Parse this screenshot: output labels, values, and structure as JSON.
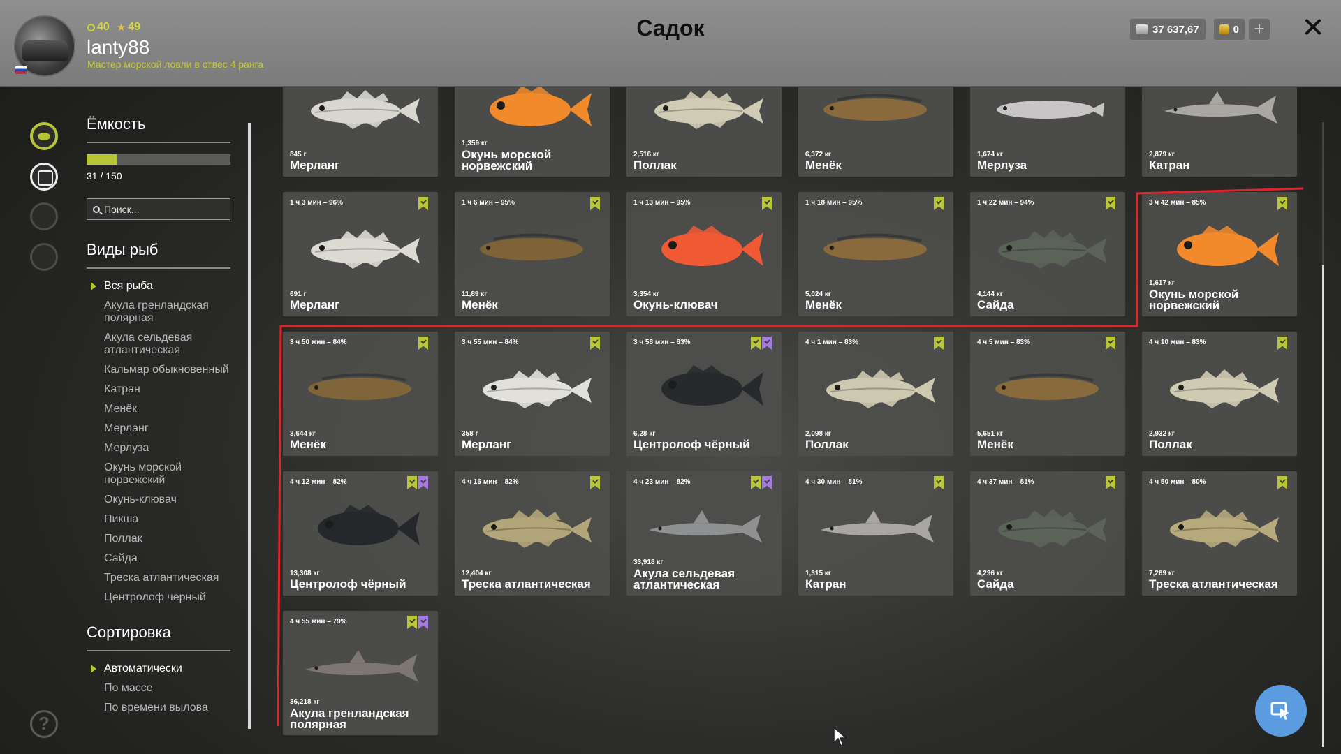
{
  "header": {
    "title": "Садок",
    "username": "lanty88",
    "level": "40",
    "stars": "49",
    "rank": "Мастер морской ловли в отвес 4 ранга",
    "silver": "37 637,67",
    "gold": "0",
    "plus_label": "+",
    "close_label": "✕"
  },
  "sidebar": {
    "capacity_title": "Ёмкость",
    "capacity_text": "31 / 150",
    "capacity_fraction": 0.207,
    "search_placeholder": "Поиск...",
    "species_title": "Виды рыб",
    "species": [
      "Вся рыба",
      "Акула гренландская полярная",
      "Акула сельдевая атлантическая",
      "Кальмар обыкновенный",
      "Катран",
      "Менёк",
      "Мерланг",
      "Мерлуза",
      "Окунь морской норвежский",
      "Окунь-клювач",
      "Пикша",
      "Поллак",
      "Сайда",
      "Треска атлантическая",
      "Центролоф чёрный"
    ],
    "sort_title": "Сортировка",
    "sort_options": [
      "Автоматически",
      "По массе",
      "По времени вылова"
    ],
    "help_label": "?"
  },
  "fish_cards": [
    {
      "time": "",
      "weight": "845 г",
      "name": "Мерланг",
      "marks": [],
      "color": "#d8d6cf",
      "shape": "cod"
    },
    {
      "time": "",
      "weight": "1,359 кг",
      "name": "Окунь морской норвежский",
      "marks": [],
      "color": "#f08a2a",
      "shape": "perch"
    },
    {
      "time": "",
      "weight": "2,516 кг",
      "name": "Поллак",
      "marks": [],
      "color": "#cfcbb4",
      "shape": "cod"
    },
    {
      "time": "",
      "weight": "6,372 кг",
      "name": "Менёк",
      "marks": [],
      "color": "#8a6a3c",
      "shape": "eel"
    },
    {
      "time": "",
      "weight": "1,674 кг",
      "name": "Мерлуза",
      "marks": [],
      "color": "#c9c5c7",
      "shape": "slim"
    },
    {
      "time": "",
      "weight": "2,879 кг",
      "name": "Катран",
      "marks": [],
      "color": "#aaa6a2",
      "shape": "shark"
    },
    {
      "time": "1 ч 3 мин – 96%",
      "weight": "691 г",
      "name": "Мерланг",
      "marks": [
        "green"
      ],
      "color": "#dcdad3",
      "shape": "cod"
    },
    {
      "time": "1 ч 6 мин – 95%",
      "weight": "11,89 кг",
      "name": "Менёк",
      "marks": [
        "green"
      ],
      "color": "#7e6238",
      "shape": "eel"
    },
    {
      "time": "1 ч 13 мин – 95%",
      "weight": "3,354 кг",
      "name": "Окунь-клювач",
      "marks": [
        "green"
      ],
      "color": "#ef5a35",
      "shape": "perch"
    },
    {
      "time": "1 ч 18 мин – 95%",
      "weight": "5,024 кг",
      "name": "Менёк",
      "marks": [
        "green"
      ],
      "color": "#8a6a3c",
      "shape": "eel"
    },
    {
      "time": "1 ч 22 мин – 94%",
      "weight": "4,144 кг",
      "name": "Сайда",
      "marks": [
        "green"
      ],
      "color": "#5b6358",
      "shape": "cod"
    },
    {
      "time": "3 ч 42 мин – 85%",
      "weight": "1,617 кг",
      "name": "Окунь морской норвежский",
      "marks": [
        "green"
      ],
      "color": "#f28a2c",
      "shape": "perch"
    },
    {
      "time": "3 ч 50 мин – 84%",
      "weight": "3,644 кг",
      "name": "Менёк",
      "marks": [
        "green"
      ],
      "color": "#80643a",
      "shape": "eel"
    },
    {
      "time": "3 ч 55 мин – 84%",
      "weight": "358 г",
      "name": "Мерланг",
      "marks": [
        "green"
      ],
      "color": "#e2e0da",
      "shape": "cod"
    },
    {
      "time": "3 ч 58 мин – 83%",
      "weight": "6,28 кг",
      "name": "Центролоф чёрный",
      "marks": [
        "green",
        "purple"
      ],
      "color": "#262a2c",
      "shape": "perch"
    },
    {
      "time": "4 ч 1 мин – 83%",
      "weight": "2,098 кг",
      "name": "Поллак",
      "marks": [
        "green"
      ],
      "color": "#cdc9b0",
      "shape": "cod"
    },
    {
      "time": "4 ч 5 мин – 83%",
      "weight": "5,651 кг",
      "name": "Менёк",
      "marks": [
        "green"
      ],
      "color": "#886a3c",
      "shape": "eel"
    },
    {
      "time": "4 ч 10 мин – 83%",
      "weight": "2,932 кг",
      "name": "Поллак",
      "marks": [
        "green"
      ],
      "color": "#cfcbb2",
      "shape": "cod"
    },
    {
      "time": "4 ч 12 мин – 82%",
      "weight": "13,308 кг",
      "name": "Центролоф чёрный",
      "marks": [
        "green",
        "purple"
      ],
      "color": "#24282a",
      "shape": "perch"
    },
    {
      "time": "4 ч 16 мин – 82%",
      "weight": "12,404 кг",
      "name": "Треска атлантическая",
      "marks": [
        "green"
      ],
      "color": "#b3a57a",
      "shape": "cod"
    },
    {
      "time": "4 ч 23 мин – 82%",
      "weight": "33,918 кг",
      "name": "Акула сельдевая атлантическая",
      "marks": [
        "green",
        "purple"
      ],
      "color": "#8f9092",
      "shape": "shark"
    },
    {
      "time": "4 ч 30 мин – 81%",
      "weight": "1,315 кг",
      "name": "Катран",
      "marks": [
        "green"
      ],
      "color": "#a9a6a3",
      "shape": "shark"
    },
    {
      "time": "4 ч 37 мин – 81%",
      "weight": "4,296 кг",
      "name": "Сайда",
      "marks": [
        "green"
      ],
      "color": "#5c6459",
      "shape": "cod"
    },
    {
      "time": "4 ч 50 мин – 80%",
      "weight": "7,269 кг",
      "name": "Треска атлантическая",
      "marks": [
        "green"
      ],
      "color": "#b6a97c",
      "shape": "cod"
    },
    {
      "time": "4 ч 55 мин – 79%",
      "weight": "36,218 кг",
      "name": "Акула гренландская полярная",
      "marks": [
        "green",
        "purple"
      ],
      "color": "#7d7672",
      "shape": "shark"
    }
  ],
  "colors": {
    "accent": "#b6c534",
    "annotation": "#e0242a",
    "bookmark_green": "#b9c637",
    "bookmark_purple": "#a57be0",
    "action_button": "#5b9ce0"
  }
}
